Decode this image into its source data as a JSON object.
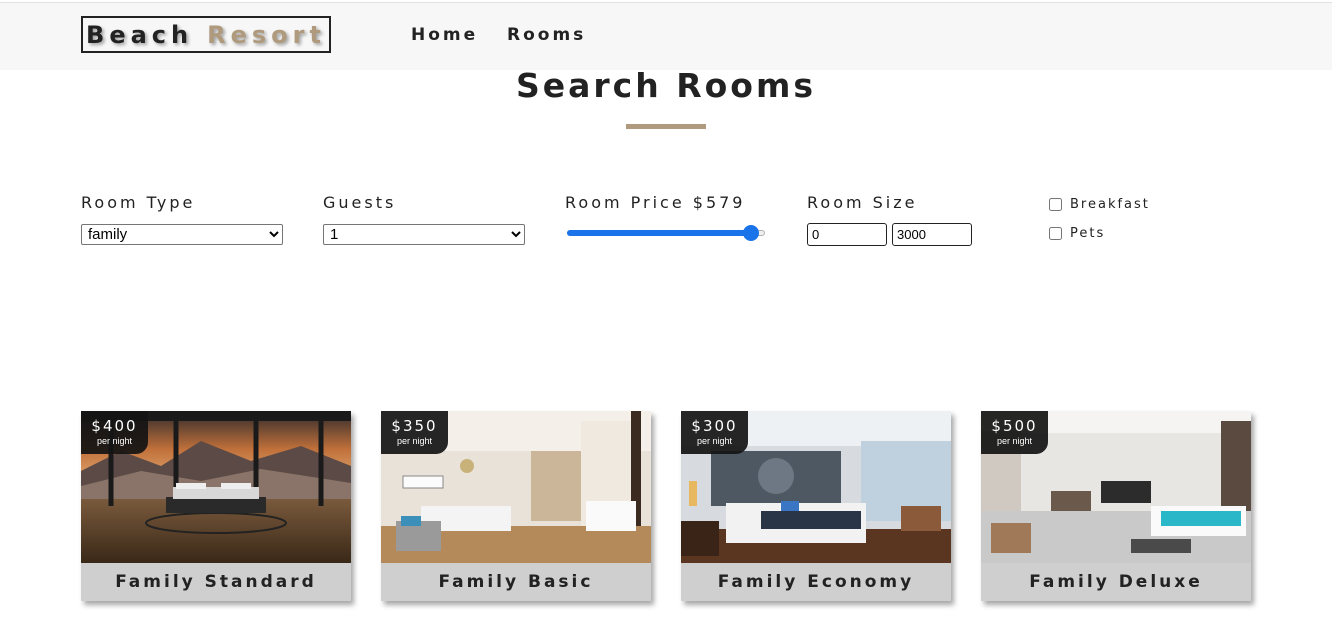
{
  "navbar": {
    "logo_part1": "Beach",
    "logo_part2": "Resort",
    "links": [
      "Home",
      "Rooms"
    ]
  },
  "page": {
    "title": "Search Rooms"
  },
  "filters": {
    "room_type": {
      "label": "Room Type",
      "value": "family"
    },
    "guests": {
      "label": "Guests",
      "value": "1"
    },
    "price": {
      "label": "Room Price $579",
      "slider_fraction": 0.93
    },
    "size": {
      "label": "Room Size",
      "min": "0",
      "max": "3000"
    },
    "checkboxes": [
      {
        "label": "Breakfast",
        "checked": false
      },
      {
        "label": "Pets",
        "checked": false
      }
    ]
  },
  "rooms": [
    {
      "name": "Family Standard",
      "price": "$400",
      "per": "per night"
    },
    {
      "name": "Family Basic",
      "price": "$350",
      "per": "per night"
    },
    {
      "name": "Family Economy",
      "price": "$300",
      "per": "per night"
    },
    {
      "name": "Family Deluxe",
      "price": "$500",
      "per": "per night"
    }
  ],
  "colors": {
    "accent": "#af9a7d",
    "slider": "#1a73e8",
    "navbar_bg": "#f7f7f7",
    "card_footer": "#cfcfcf"
  }
}
